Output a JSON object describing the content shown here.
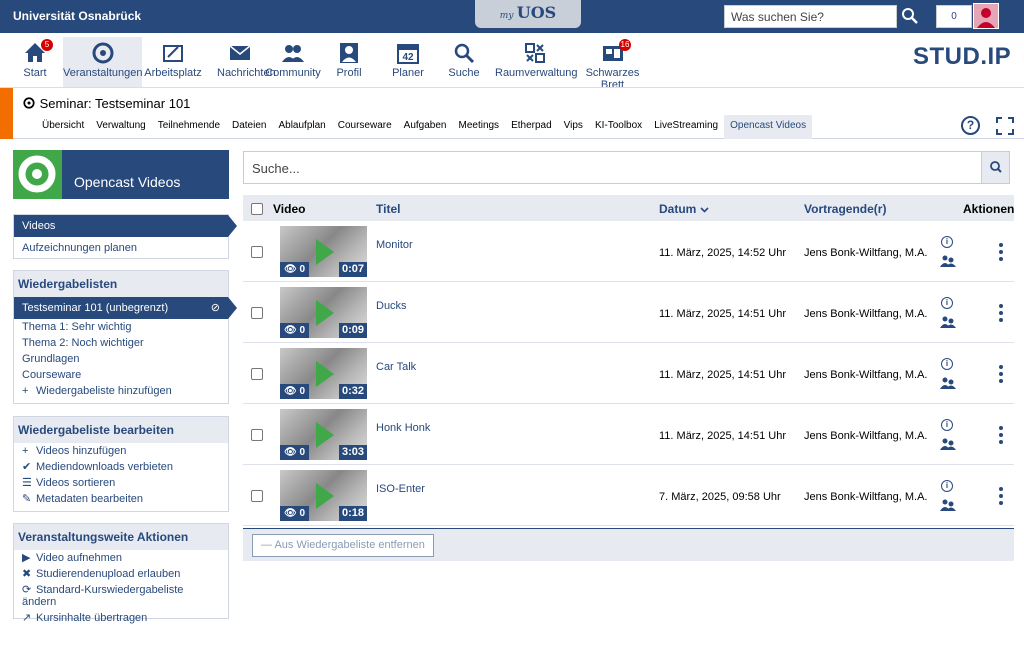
{
  "topbar": {
    "university": "Universität Osnabrück",
    "my": "my",
    "uos": "UOS",
    "search_placeholder": "Was suchen Sie?",
    "counter": "0"
  },
  "nav": [
    {
      "label": "Start",
      "icon": "home-icon",
      "badge": "5"
    },
    {
      "label": "Veranstaltungen",
      "icon": "seminar-icon",
      "badge": ""
    },
    {
      "label": "Arbeitsplatz",
      "icon": "workplace-icon",
      "badge": ""
    },
    {
      "label": "Nachrichten",
      "icon": "mail-icon",
      "badge": ""
    },
    {
      "label": "Community",
      "icon": "community-icon",
      "badge": ""
    },
    {
      "label": "Profil",
      "icon": "profile-icon",
      "badge": ""
    },
    {
      "label": "Planer",
      "icon": "calendar-icon",
      "badge": "",
      "day": "42"
    },
    {
      "label": "Suche",
      "icon": "search-icon",
      "badge": ""
    },
    {
      "label": "Raumverwaltung",
      "icon": "room-icon",
      "badge": ""
    },
    {
      "label": "Schwarzes Brett",
      "icon": "board-icon",
      "badge": "16"
    }
  ],
  "logo": {
    "text": "STUD.IP"
  },
  "course": {
    "title": "Seminar: Testseminar 101",
    "tabs": [
      "Übersicht",
      "Verwaltung",
      "Teilnehmende",
      "Dateien",
      "Ablaufplan",
      "Courseware",
      "Aufgaben",
      "Meetings",
      "Etherpad",
      "Vips",
      "KI-Toolbox",
      "LiveStreaming",
      "Opencast Videos"
    ],
    "active_tab": "Opencast Videos"
  },
  "sidebar": {
    "header": "Opencast Videos",
    "views": [
      "Videos",
      "Aufzeichnungen planen"
    ],
    "playlists_title": "Wiedergabelisten",
    "playlists": [
      "Testseminar 101 (unbegrenzt)",
      "Thema 1: Sehr wichtig",
      "Thema 2: Noch wichtiger",
      "Grundlagen",
      "Courseware"
    ],
    "add_playlist": "Wiedergabeliste hinzufügen",
    "edit_title": "Wiedergabeliste bearbeiten",
    "edit_actions": [
      "Videos hinzufügen",
      "Mediendownloads verbieten",
      "Videos sortieren",
      "Metadaten bearbeiten"
    ],
    "course_title": "Veranstaltungsweite Aktionen",
    "course_actions": [
      "Video aufnehmen",
      "Studierendenupload erlauben",
      "Standard-Kurswiedergabeliste ändern",
      "Kursinhalte übertragen"
    ]
  },
  "main": {
    "search_placeholder": "Suche...",
    "columns": {
      "video": "Video",
      "title": "Titel",
      "date": "Datum",
      "presenter": "Vortragende(r)",
      "actions": "Aktionen"
    },
    "rows": [
      {
        "title": "Monitor",
        "views": "0",
        "duration": "0:07",
        "date": "11. März, 2025, 14:52 Uhr",
        "presenter": "Jens Bonk-Wiltfang, M.A."
      },
      {
        "title": "Ducks",
        "views": "0",
        "duration": "0:09",
        "date": "11. März, 2025, 14:51 Uhr",
        "presenter": "Jens Bonk-Wiltfang, M.A."
      },
      {
        "title": "Car Talk",
        "views": "0",
        "duration": "0:32",
        "date": "11. März, 2025, 14:51 Uhr",
        "presenter": "Jens Bonk-Wiltfang, M.A."
      },
      {
        "title": "Honk Honk",
        "views": "0",
        "duration": "3:03",
        "date": "11. März, 2025, 14:51 Uhr",
        "presenter": "Jens Bonk-Wiltfang, M.A."
      },
      {
        "title": "ISO-Enter",
        "views": "0",
        "duration": "0:18",
        "date": "7. März, 2025, 09:58 Uhr",
        "presenter": "Jens Bonk-Wiltfang, M.A."
      }
    ],
    "remove_button": "Aus Wiedergabeliste entfernen"
  }
}
